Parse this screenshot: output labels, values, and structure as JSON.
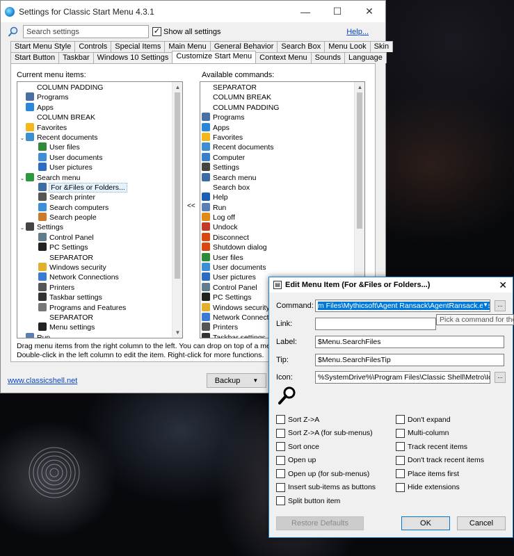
{
  "window": {
    "title": "Settings for Classic Start Menu 4.3.1",
    "controls": {
      "minimize": "—",
      "maximize": "☐",
      "close": "✕"
    }
  },
  "search": {
    "placeholder": "Search settings",
    "show_all_label": "Show all settings",
    "show_all_checked": true,
    "help_label": "Help..."
  },
  "tabs_row1": [
    "Start Menu Style",
    "Controls",
    "Special Items",
    "Main Menu",
    "General Behavior",
    "Search Box",
    "Menu Look",
    "Skin"
  ],
  "tabs_row2": [
    "Start Button",
    "Taskbar",
    "Windows 10 Settings",
    "Customize Start Menu",
    "Context Menu",
    "Sounds",
    "Language"
  ],
  "active_tab": "Customize Start Menu",
  "panel": {
    "left_label": "Current menu items:",
    "right_label": "Available commands:",
    "move_arrows": "<<",
    "help_line1": "Drag menu items from the right column to the left. You can drop on top of a menu item",
    "help_line2": "Double-click in the left column to edit the item. Right-click for more functions."
  },
  "tree_items": [
    {
      "label": "COLUMN PADDING",
      "indent": 1,
      "icon": "none"
    },
    {
      "label": "Programs",
      "indent": 1,
      "icon": "programs-icon"
    },
    {
      "label": "Apps",
      "indent": 1,
      "icon": "apps-icon"
    },
    {
      "label": "COLUMN BREAK",
      "indent": 1,
      "icon": "none"
    },
    {
      "label": "Favorites",
      "indent": 1,
      "icon": "star-icon"
    },
    {
      "label": "Recent documents",
      "indent": 0,
      "icon": "documents-icon",
      "expanded": true
    },
    {
      "label": "User files",
      "indent": 2,
      "icon": "user-icon"
    },
    {
      "label": "User documents",
      "indent": 2,
      "icon": "documents-icon"
    },
    {
      "label": "User pictures",
      "indent": 2,
      "icon": "pictures-icon"
    },
    {
      "label": "Search menu",
      "indent": 0,
      "icon": "search-menu-icon",
      "expanded": true
    },
    {
      "label": "For &Files or Folders...",
      "indent": 2,
      "icon": "magnifier-icon",
      "selected": true
    },
    {
      "label": "Search printer",
      "indent": 2,
      "icon": "printer-icon"
    },
    {
      "label": "Search computers",
      "indent": 2,
      "icon": "globe-icon"
    },
    {
      "label": "Search people",
      "indent": 2,
      "icon": "people-icon"
    },
    {
      "label": "Settings",
      "indent": 0,
      "icon": "settings-icon",
      "expanded": true
    },
    {
      "label": "Control Panel",
      "indent": 2,
      "icon": "control-panel-icon"
    },
    {
      "label": "PC Settings",
      "indent": 2,
      "icon": "gear-icon"
    },
    {
      "label": "SEPARATOR",
      "indent": 2,
      "icon": "none"
    },
    {
      "label": "Windows security",
      "indent": 2,
      "icon": "lock-icon"
    },
    {
      "label": "Network Connections",
      "indent": 2,
      "icon": "network-icon"
    },
    {
      "label": "Printers",
      "indent": 2,
      "icon": "printer-icon"
    },
    {
      "label": "Taskbar settings",
      "indent": 2,
      "icon": "taskbar-icon"
    },
    {
      "label": "Programs and Features",
      "indent": 2,
      "icon": "box-icon"
    },
    {
      "label": "SEPARATOR",
      "indent": 2,
      "icon": "none"
    },
    {
      "label": "Menu settings",
      "indent": 2,
      "icon": "menu-settings-icon"
    },
    {
      "label": "Run",
      "indent": 1,
      "icon": "run-icon"
    }
  ],
  "commands": [
    {
      "label": "SEPARATOR",
      "icon": "none"
    },
    {
      "label": "COLUMN BREAK",
      "icon": "none"
    },
    {
      "label": "COLUMN PADDING",
      "icon": "none"
    },
    {
      "label": "Programs",
      "icon": "programs-icon"
    },
    {
      "label": "Apps",
      "icon": "apps-icon"
    },
    {
      "label": "Favorites",
      "icon": "star-icon"
    },
    {
      "label": "Recent documents",
      "icon": "documents-icon"
    },
    {
      "label": "Computer",
      "icon": "computer-icon"
    },
    {
      "label": "Settings",
      "icon": "settings-icon"
    },
    {
      "label": "Search menu",
      "icon": "magnifier-icon"
    },
    {
      "label": "Search box",
      "icon": "none"
    },
    {
      "label": "Help",
      "icon": "help-icon"
    },
    {
      "label": "Run",
      "icon": "run-icon"
    },
    {
      "label": "Log off",
      "icon": "logoff-icon"
    },
    {
      "label": "Undock",
      "icon": "undock-icon"
    },
    {
      "label": "Disconnect",
      "icon": "disconnect-icon"
    },
    {
      "label": "Shutdown dialog",
      "icon": "shutdown-icon"
    },
    {
      "label": "User files",
      "icon": "user-icon"
    },
    {
      "label": "User documents",
      "icon": "documents-icon"
    },
    {
      "label": "User pictures",
      "icon": "pictures-icon"
    },
    {
      "label": "Control Panel",
      "icon": "control-panel-icon"
    },
    {
      "label": "PC Settings",
      "icon": "gear-icon"
    },
    {
      "label": "Windows security",
      "icon": "lock-icon"
    },
    {
      "label": "Network Connections",
      "icon": "network-icon"
    },
    {
      "label": "Printers",
      "icon": "printer-icon"
    },
    {
      "label": "Taskbar settings",
      "icon": "taskbar-icon"
    }
  ],
  "footer": {
    "link": "www.classicshell.net",
    "backup_label": "Backup"
  },
  "dialog": {
    "title": "Edit Menu Item (For &Files or Folders...)",
    "command_label": "Command:",
    "command_value": "m Files\\Mythicsoft\\Agent Ransack\\AgentRansack.exe\"",
    "tooltip": "Pick a command for the m",
    "link_label": "Link:",
    "link_value": "",
    "label_label": "Label:",
    "label_value": "$Menu.SearchFiles",
    "tip_label": "Tip:",
    "tip_value": "$Menu.SearchFilesTip",
    "icon_label": "Icon:",
    "icon_value": "%SystemDrive%\\Program Files\\Classic Shell\\Metro\\IconGr",
    "browse_label": "...",
    "options_left": [
      "Sort Z->A",
      "Sort Z->A (for sub-menus)",
      "Sort once",
      "Open up",
      "Open up (for sub-menus)",
      "Insert sub-items as buttons",
      "Split button item"
    ],
    "options_right": [
      "Don't expand",
      "Multi-column",
      "Track recent items",
      "Don't track recent items",
      "Place items first",
      "Hide extensions"
    ],
    "restore_label": "Restore Defaults",
    "ok_label": "OK",
    "cancel_label": "Cancel"
  },
  "colors": {
    "accent": "#0078d7",
    "link": "#0645c8",
    "window_bg": "#f0f0f0"
  }
}
